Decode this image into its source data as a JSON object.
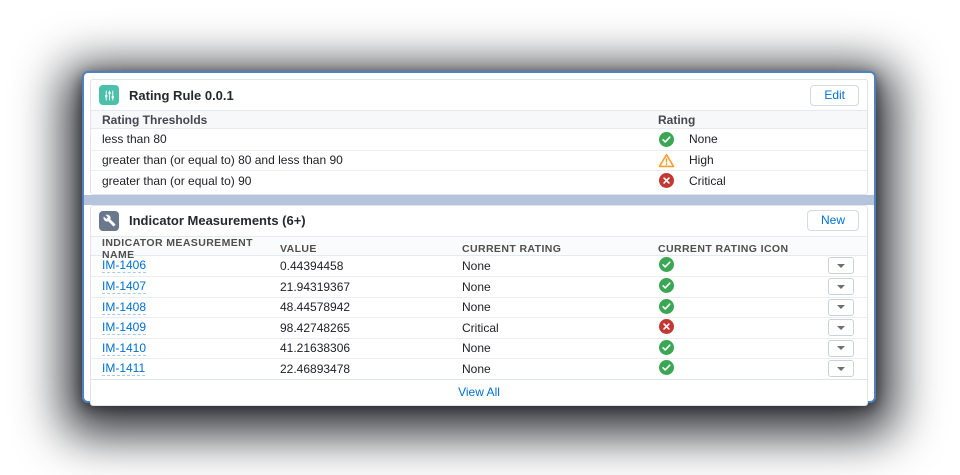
{
  "cards": {
    "rating_rule": {
      "title": "Rating Rule 0.0.1",
      "edit_button_label": "Edit",
      "header_icon": "sliders-icon",
      "columns": {
        "threshold": "Rating Thresholds",
        "rating": "Rating"
      },
      "rows": [
        {
          "threshold": "less than 80",
          "rating_label": "None",
          "icon": "success"
        },
        {
          "threshold": "greater than (or equal to) 80 and less than 90",
          "rating_label": "High",
          "icon": "warning"
        },
        {
          "threshold": "greater than (or equal to) 90",
          "rating_label": "Critical",
          "icon": "error"
        }
      ]
    },
    "measurements": {
      "title": "Indicator Measurements (6+)",
      "new_button_label": "New",
      "header_icon": "wrench-icon",
      "columns": {
        "name": "INDICATOR MEASUREMENT NAME",
        "value": "VALUE",
        "rating": "CURRENT RATING",
        "rating_icon": "CURRENT RATING ICON"
      },
      "rows": [
        {
          "name": "IM-1406",
          "value": "0.44394458",
          "rating": "None",
          "icon": "success"
        },
        {
          "name": "IM-1407",
          "value": "21.94319367",
          "rating": "None",
          "icon": "success"
        },
        {
          "name": "IM-1408",
          "value": "48.44578942",
          "rating": "None",
          "icon": "success"
        },
        {
          "name": "IM-1409",
          "value": "98.42748265",
          "rating": "Critical",
          "icon": "error"
        },
        {
          "name": "IM-1410",
          "value": "41.21638306",
          "rating": "None",
          "icon": "success"
        },
        {
          "name": "IM-1411",
          "value": "22.46893478",
          "rating": "None",
          "icon": "success"
        }
      ],
      "view_all_label": "View All",
      "row_action_icon": "chevron-down"
    }
  },
  "colors": {
    "window_border": "#4e80c2",
    "link": "#0070d2",
    "success": "#3ba755",
    "warning": "#ff9e2c",
    "error": "#c23934",
    "rating_rule_icon_bg": "#4bc0ab",
    "measurements_icon_bg": "#69788c",
    "card_gap_band": "#b5c3dc"
  }
}
